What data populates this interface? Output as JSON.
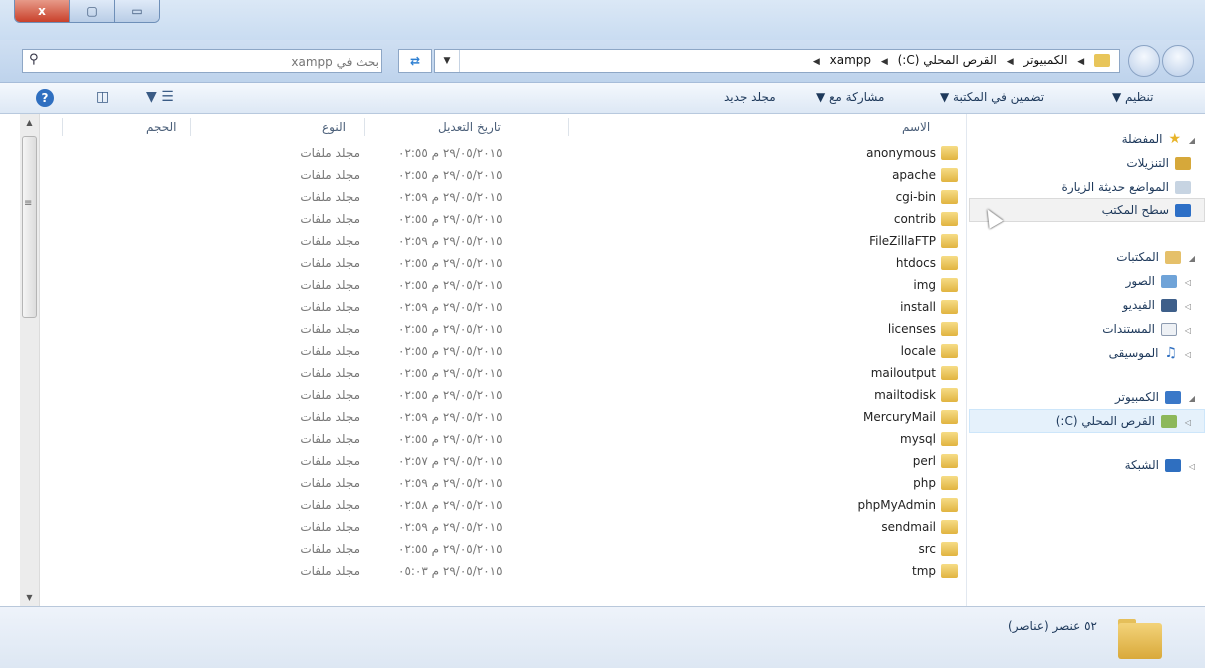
{
  "window": {
    "close_label": "x",
    "max_label": "▢",
    "min_label": "▭"
  },
  "address": {
    "crumbs": [
      "الكمبيوتر",
      "القرص المحلي (C:)",
      "xampp"
    ],
    "search_placeholder": "بحث في xampp"
  },
  "toolbar": {
    "organize": "تنظيم ▼",
    "include_library": "تضمين في المكتبة ▼",
    "share_with": "مشاركة مع ▼",
    "new_folder": "مجلد جديد"
  },
  "nav": {
    "favorites": "المفضلة",
    "downloads": "التنزيلات",
    "recent_places": "المواضع حديثة الزيارة",
    "desktop": "سطح المكتب",
    "libraries": "المكتبات",
    "pictures": "الصور",
    "videos": "الفيديو",
    "documents": "المستندات",
    "music": "الموسيقى",
    "computer": "الكمبيوتر",
    "local_disk": "القرص المحلي (C:)",
    "network": "الشبكة"
  },
  "columns": {
    "name": "الاسم",
    "date": "تاريخ التعديل",
    "type": "النوع",
    "size": "الحجم"
  },
  "files": [
    {
      "name": "anonymous",
      "date": "٢٩/٠٥/٢٠١٥ م ٠٢:٥٥",
      "type": "مجلد ملفات"
    },
    {
      "name": "apache",
      "date": "٢٩/٠٥/٢٠١٥ م ٠٢:٥٥",
      "type": "مجلد ملفات"
    },
    {
      "name": "cgi-bin",
      "date": "٢٩/٠٥/٢٠١٥ م ٠٢:٥٩",
      "type": "مجلد ملفات"
    },
    {
      "name": "contrib",
      "date": "٢٩/٠٥/٢٠١٥ م ٠٢:٥٥",
      "type": "مجلد ملفات"
    },
    {
      "name": "FileZillaFTP",
      "date": "٢٩/٠٥/٢٠١٥ م ٠٢:٥٩",
      "type": "مجلد ملفات"
    },
    {
      "name": "htdocs",
      "date": "٢٩/٠٥/٢٠١٥ م ٠٢:٥٥",
      "type": "مجلد ملفات"
    },
    {
      "name": "img",
      "date": "٢٩/٠٥/٢٠١٥ م ٠٢:٥٥",
      "type": "مجلد ملفات"
    },
    {
      "name": "install",
      "date": "٢٩/٠٥/٢٠١٥ م ٠٢:٥٩",
      "type": "مجلد ملفات"
    },
    {
      "name": "licenses",
      "date": "٢٩/٠٥/٢٠١٥ م ٠٢:٥٥",
      "type": "مجلد ملفات"
    },
    {
      "name": "locale",
      "date": "٢٩/٠٥/٢٠١٥ م ٠٢:٥٥",
      "type": "مجلد ملفات"
    },
    {
      "name": "mailoutput",
      "date": "٢٩/٠٥/٢٠١٥ م ٠٢:٥٥",
      "type": "مجلد ملفات"
    },
    {
      "name": "mailtodisk",
      "date": "٢٩/٠٥/٢٠١٥ م ٠٢:٥٥",
      "type": "مجلد ملفات"
    },
    {
      "name": "MercuryMail",
      "date": "٢٩/٠٥/٢٠١٥ م ٠٢:٥٩",
      "type": "مجلد ملفات"
    },
    {
      "name": "mysql",
      "date": "٢٩/٠٥/٢٠١٥ م ٠٢:٥٥",
      "type": "مجلد ملفات"
    },
    {
      "name": "perl",
      "date": "٢٩/٠٥/٢٠١٥ م ٠٢:٥٧",
      "type": "مجلد ملفات"
    },
    {
      "name": "php",
      "date": "٢٩/٠٥/٢٠١٥ م ٠٢:٥٩",
      "type": "مجلد ملفات"
    },
    {
      "name": "phpMyAdmin",
      "date": "٢٩/٠٥/٢٠١٥ م ٠٢:٥٨",
      "type": "مجلد ملفات"
    },
    {
      "name": "sendmail",
      "date": "٢٩/٠٥/٢٠١٥ م ٠٢:٥٩",
      "type": "مجلد ملفات"
    },
    {
      "name": "src",
      "date": "٢٩/٠٥/٢٠١٥ م ٠٢:٥٥",
      "type": "مجلد ملفات"
    },
    {
      "name": "tmp",
      "date": "٢٩/٠٥/٢٠١٥ م ٠٥:٠٣",
      "type": "مجلد ملفات"
    }
  ],
  "details": {
    "item_count": "٥٢ عنصر (عناصر)"
  },
  "colors": {
    "folder": "#e1b441",
    "selection": "#e5f1fb",
    "chrome": "#c9dcf1"
  }
}
